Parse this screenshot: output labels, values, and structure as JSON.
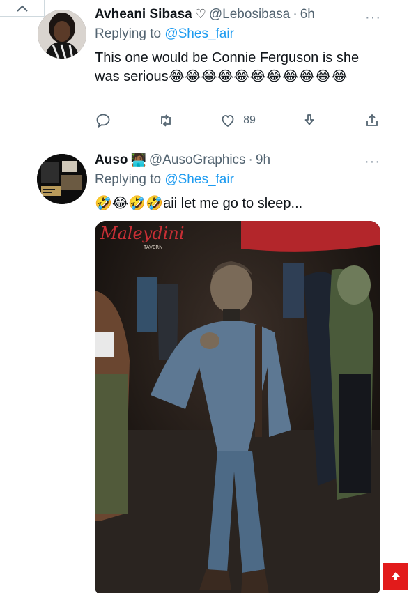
{
  "tweets": [
    {
      "display_name": "Avheani Sibasa",
      "name_emoji": "♡",
      "handle": "@Lebosibasa",
      "time": "6h",
      "reply_prefix": "Replying to ",
      "reply_mention": "@Shes_fair",
      "text": "This one would be Connie Ferguson is she was serious😂😂😂😂😂😂😂😂😂😂😂",
      "likes": "89"
    },
    {
      "display_name": "Auso",
      "name_emoji": "🧑🏾‍💻",
      "handle": "@AusoGraphics",
      "time": "9h",
      "reply_prefix": "Replying to ",
      "reply_mention": "@Shes_fair",
      "text": "🤣😂🤣🤣aii let me go to sleep...",
      "media_sign": "Maleydini",
      "media_sign_sub": "TAVERN"
    }
  ],
  "icons": [
    "chevron-up-icon",
    "more-icon",
    "reply-icon",
    "retweet-icon",
    "like-icon",
    "download-icon",
    "share-icon",
    "arrow-up-icon"
  ],
  "colors": {
    "accent": "#1d9bf0",
    "muted": "#536471",
    "scroll_top": "#e21b1b"
  }
}
